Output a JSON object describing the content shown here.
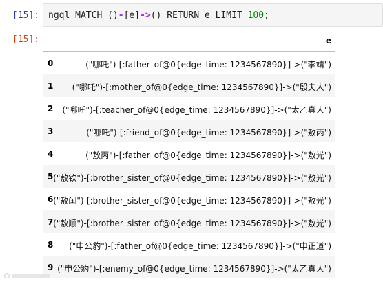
{
  "cell_input": {
    "prompt": "[15]:",
    "code_tokens": [
      {
        "t": "ngql MATCH ()",
        "c": "plain"
      },
      {
        "t": "-",
        "c": "op"
      },
      {
        "t": "[e]",
        "c": "plain"
      },
      {
        "t": "->",
        "c": "op"
      },
      {
        "t": "() RETURN e LIMIT ",
        "c": "plain"
      },
      {
        "t": "100",
        "c": "num"
      },
      {
        "t": ";",
        "c": "plain"
      }
    ]
  },
  "cell_output": {
    "prompt": "[15]:",
    "table": {
      "column_header": "e",
      "rows": [
        {
          "index": "0",
          "value": "(\"哪吒\")-[:father_of@0{edge_time: 1234567890}]->(\"李靖\")"
        },
        {
          "index": "1",
          "value": "(\"哪吒\")-[:mother_of@0{edge_time: 1234567890}]->(\"殷夫人\")"
        },
        {
          "index": "2",
          "value": "(\"哪吒\")-[:teacher_of@0{edge_time: 1234567890}]->(\"太乙真人\")"
        },
        {
          "index": "3",
          "value": "(\"哪吒\")-[:friend_of@0{edge_time: 1234567890}]->(\"敖丙\")"
        },
        {
          "index": "4",
          "value": "(\"敖丙\")-[:father_of@0{edge_time: 1234567890}]->(\"敖光\")"
        },
        {
          "index": "5",
          "value": "(\"敖钦\")-[:brother_sister_of@0{edge_time: 1234567890}]->(\"敖光\")"
        },
        {
          "index": "6",
          "value": "(\"敖闰\")-[:brother_sister_of@0{edge_time: 1234567890}]->(\"敖光\")"
        },
        {
          "index": "7",
          "value": "(\"敖顺\")-[:brother_sister_of@0{edge_time: 1234567890}]->(\"敖光\")"
        },
        {
          "index": "8",
          "value": "(\"申公豹\")-[:father_of@0{edge_time: 1234567890}]->(\"申正道\")"
        },
        {
          "index": "9",
          "value": "(\"申公豹\")-[:enemy_of@0{edge_time: 1234567890}]->(\"太乙真人\")"
        }
      ]
    }
  },
  "colors": {
    "input_prompt": "#303f9f",
    "output_prompt": "#d84315",
    "operator": "#aa22ff",
    "number": "#008800",
    "stripe": "#f5f5f5"
  }
}
